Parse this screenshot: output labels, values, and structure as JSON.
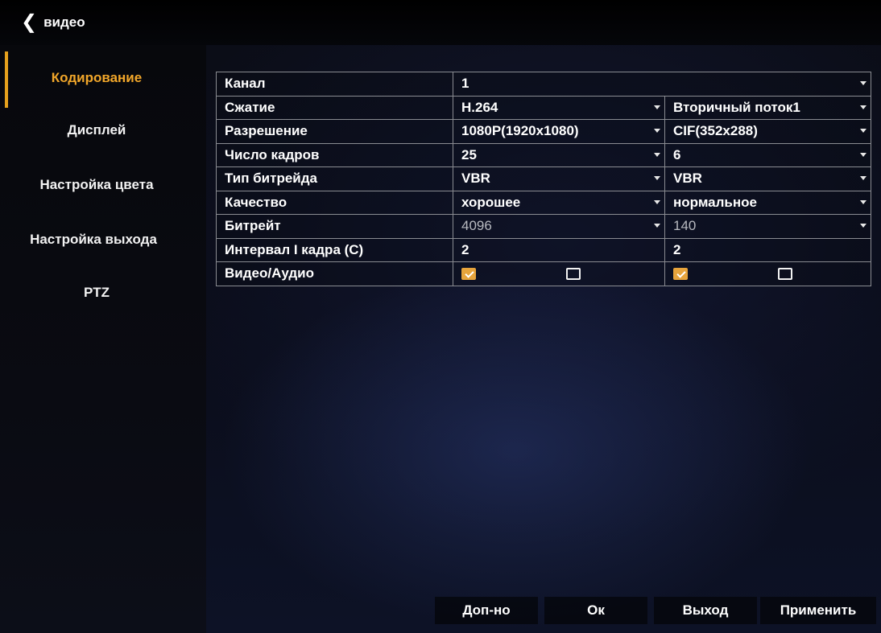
{
  "header": {
    "back_label": "видео"
  },
  "sidebar": {
    "items": [
      {
        "label": "Кодирование",
        "active": true
      },
      {
        "label": "Дисплей"
      },
      {
        "label": "Настройка цвета"
      },
      {
        "label": "Настройка выхода"
      },
      {
        "label": "PTZ"
      }
    ]
  },
  "encoding": {
    "rows": {
      "channel": {
        "label": "Канал",
        "value": "1"
      },
      "compression": {
        "label": "Сжатие",
        "main": "H.264",
        "sub": "Вторичный поток1"
      },
      "resolution": {
        "label": "Разрешение",
        "main": "1080P(1920x1080)",
        "sub": "CIF(352x288)"
      },
      "framerate": {
        "label": "Число кадров",
        "main": "25",
        "sub": "6"
      },
      "bitrate_type": {
        "label": "Тип битрейда",
        "main": "VBR",
        "sub": "VBR"
      },
      "quality": {
        "label": "Качество",
        "main": "хорошее",
        "sub": "нормальное"
      },
      "bitrate": {
        "label": "Битрейт",
        "main": "4096",
        "sub": "140"
      },
      "iframe": {
        "label": "Интервал I кадра (С)",
        "main": "2",
        "sub": "2"
      },
      "video_audio": {
        "label": "Видео/Аудио",
        "main_video": true,
        "main_audio": false,
        "sub_video": true,
        "sub_audio": false
      }
    }
  },
  "buttons": {
    "advanced": "Доп-но",
    "ok": "Ок",
    "exit": "Выход",
    "apply": "Применить"
  },
  "colors": {
    "accent": "#e6a11d",
    "checkbox_checked": "#e7a43c"
  }
}
